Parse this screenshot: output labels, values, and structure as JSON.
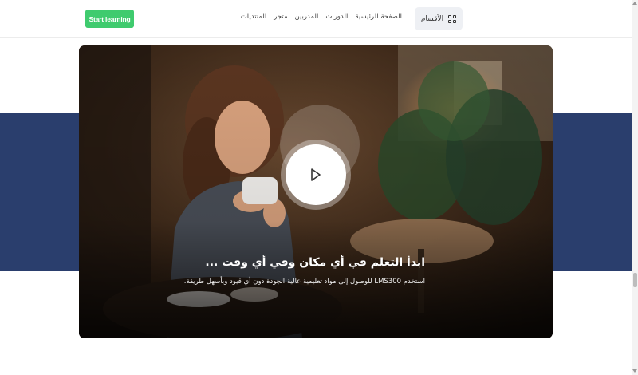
{
  "header": {
    "start_button": "Start learning",
    "nav_items": [
      "الصفحة الرئيسية",
      "الدورات",
      "المدربين",
      "متجر",
      "المنتديات"
    ],
    "categories_button": "الأقسام",
    "categories_icon": "grid-icon"
  },
  "hero": {
    "title": "ابدأ التعلم في أي مكان وفي أي وقت ...",
    "subtitle": "استخدم LMS300 للوصول إلى مواد تعليمية عالية الجودة دون أي قيود وبأسهل طريقة.",
    "play_icon": "play-icon"
  },
  "colors": {
    "accent_green": "#3fcb6e",
    "band_navy": "#2a3e6d",
    "category_bg": "#eef0f4"
  }
}
